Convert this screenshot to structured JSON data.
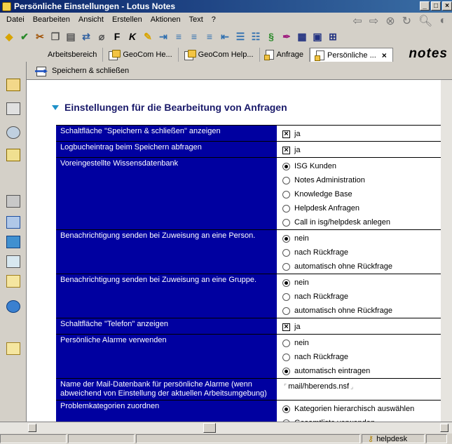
{
  "window": {
    "title": "Persönliche Einstellungen - Lotus Notes",
    "brand": "notes"
  },
  "menu": [
    {
      "label": "Datei"
    },
    {
      "label": "Bearbeiten"
    },
    {
      "label": "Ansicht"
    },
    {
      "label": "Erstellen"
    },
    {
      "label": "Aktionen"
    },
    {
      "label": "Text"
    },
    {
      "label": "?"
    }
  ],
  "tabs": [
    {
      "label": "Arbeitsbereich"
    },
    {
      "label": "GeoCom He..."
    },
    {
      "label": "GeoCom Help..."
    },
    {
      "label": "Anfrage"
    },
    {
      "label": "Persönliche ..."
    }
  ],
  "actionbar": {
    "save_close": "Speichern & schließen"
  },
  "section": {
    "title": "Einstellungen für die Bearbeitung von Anfragen"
  },
  "fields": [
    {
      "label": "Schaltfläche \"Speichern & schließen\" anzeigen",
      "type": "checkbox",
      "options": [
        {
          "text": "ja",
          "checked": true
        }
      ]
    },
    {
      "label": "Logbucheintrag beim Speichern abfragen",
      "type": "checkbox",
      "options": [
        {
          "text": "ja",
          "checked": true
        }
      ]
    },
    {
      "label": "Voreingestellte Wissensdatenbank",
      "type": "radio",
      "options": [
        {
          "text": "ISG Kunden",
          "checked": true
        },
        {
          "text": "Notes Administration",
          "checked": false
        },
        {
          "text": "Knowledge Base",
          "checked": false
        },
        {
          "text": "Helpdesk Anfragen",
          "checked": false
        },
        {
          "text": "Call in isg/helpdesk anlegen",
          "checked": false
        }
      ]
    },
    {
      "label": "Benachrichtigung senden bei Zuweisung an eine Person.",
      "type": "radio",
      "options": [
        {
          "text": "nein",
          "checked": true
        },
        {
          "text": "nach Rückfrage",
          "checked": false
        },
        {
          "text": "automatisch ohne Rückfrage",
          "checked": false
        }
      ]
    },
    {
      "label": "Benachrichtigung senden bei Zuweisung an eine Gruppe.",
      "type": "radio",
      "options": [
        {
          "text": "nein",
          "checked": true
        },
        {
          "text": "nach Rückfrage",
          "checked": false
        },
        {
          "text": "automatisch ohne Rückfrage",
          "checked": false
        }
      ]
    },
    {
      "label": "Schaltfläche \"Telefon\" anzeigen",
      "type": "checkbox",
      "options": [
        {
          "text": "ja",
          "checked": true
        }
      ]
    },
    {
      "label": "Persönliche Alarme verwenden",
      "type": "radio",
      "options": [
        {
          "text": "nein",
          "checked": false
        },
        {
          "text": "nach Rückfrage",
          "checked": false
        },
        {
          "text": "automatisch eintragen",
          "checked": true
        }
      ]
    },
    {
      "label": "Name der Mail-Datenbank für persönliche Alarme (wenn abweichend von Einstellung der aktuellen Arbeitsumgebung)",
      "type": "text",
      "value": "mail/hberends.nsf"
    },
    {
      "label": "Problemkategorien zuordnen",
      "type": "radio",
      "options": [
        {
          "text": "Kategorien hierarchisch auswählen",
          "checked": true
        },
        {
          "text": "Gesamtliste verwenden",
          "checked": false
        }
      ]
    }
  ],
  "status": {
    "db": "helpdesk"
  }
}
